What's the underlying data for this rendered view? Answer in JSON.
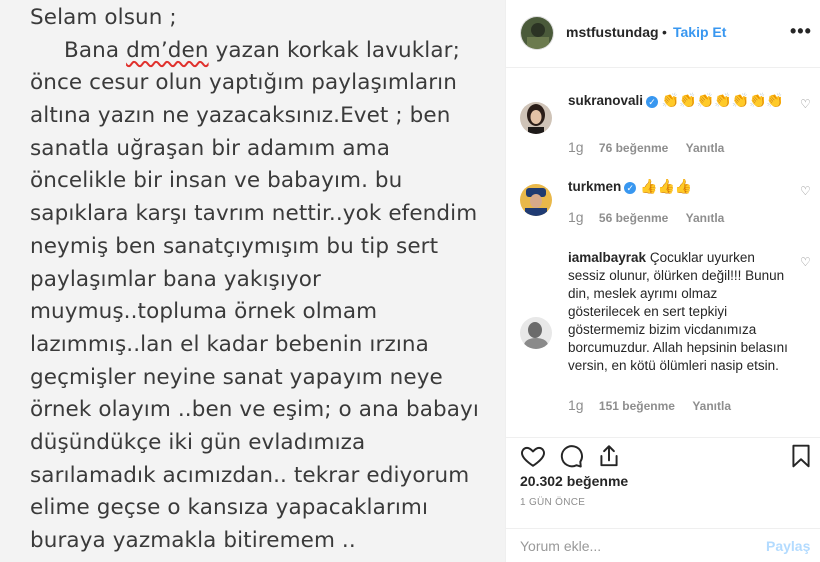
{
  "post_image": {
    "lines": [
      "Selam olsun ;",
      "Bana ",
      "önce cesur olun yaptığım paylaşımların",
      "altına yazın ne yazacaksınız.Evet ; ben",
      "sanatla uğraşan bir adamım ama",
      "öncelikle bir insan ve babayım. bu",
      "sapıklara karşı tavrım nettir..yok efendim",
      "neymiş ben sanatçıymışım bu tip sert",
      "paylaşımlar bana yakışıyor",
      "muymuş..topluma örnek olmam",
      "lazımmış..lan el kadar bebenin ırzına",
      "geçmişler neyine sanat yapayım neye",
      "örnek olayım ..ben ve eşim; o ana babayı",
      "düşündükçe iki gün evladımıza",
      "sarılamadık acımızdan.. tekrar ediyorum",
      "elime geçse o kansıza yapacaklarımı",
      "buraya yazmakla bitiremem .."
    ],
    "line2_misspelled": "dm’den",
    "line2_rest": " yazan korkak lavuklar;"
  },
  "header": {
    "username": "mstfustundag",
    "separator": "•",
    "follow_label": "Takip Et",
    "more_label": "•••"
  },
  "comments": [
    {
      "username": "sukranovali",
      "verified": true,
      "text": "👏👏👏👏👏👏👏",
      "age": "1g",
      "likes": "76 beğenme",
      "reply": "Yanıtla"
    },
    {
      "username": "turkmen",
      "verified": true,
      "text": "👍👍👍",
      "age": "1g",
      "likes": "56 beğenme",
      "reply": "Yanıtla"
    },
    {
      "username": "iamalbayrak",
      "verified": false,
      "text": "Çocuklar uyurken sessiz olunur, ölürken değil!!! Bunun din, meslek ayrımı olmaz gösterilecek en sert tepkiyi göstermemiz bizim vicdanımıza borcumuzdur. Allah hepsinin belasını versin, en kötü ölümleri nasip etsin.",
      "age": "1g",
      "likes": "151 beğenme",
      "reply": "Yanıtla"
    }
  ],
  "verified_mark": "✓",
  "heart_small": "♡",
  "actions": {
    "like_count": "20.302 beğenme",
    "time_ago": "1 GÜN ÖNCE"
  },
  "add_comment": {
    "placeholder": "Yorum ekle...",
    "post_label": "Paylaş"
  },
  "colors": {
    "accent": "#3897f0",
    "post_disabled": "#b3dbff",
    "muted": "#8e8e8e",
    "misspelling": "#e0312d"
  }
}
